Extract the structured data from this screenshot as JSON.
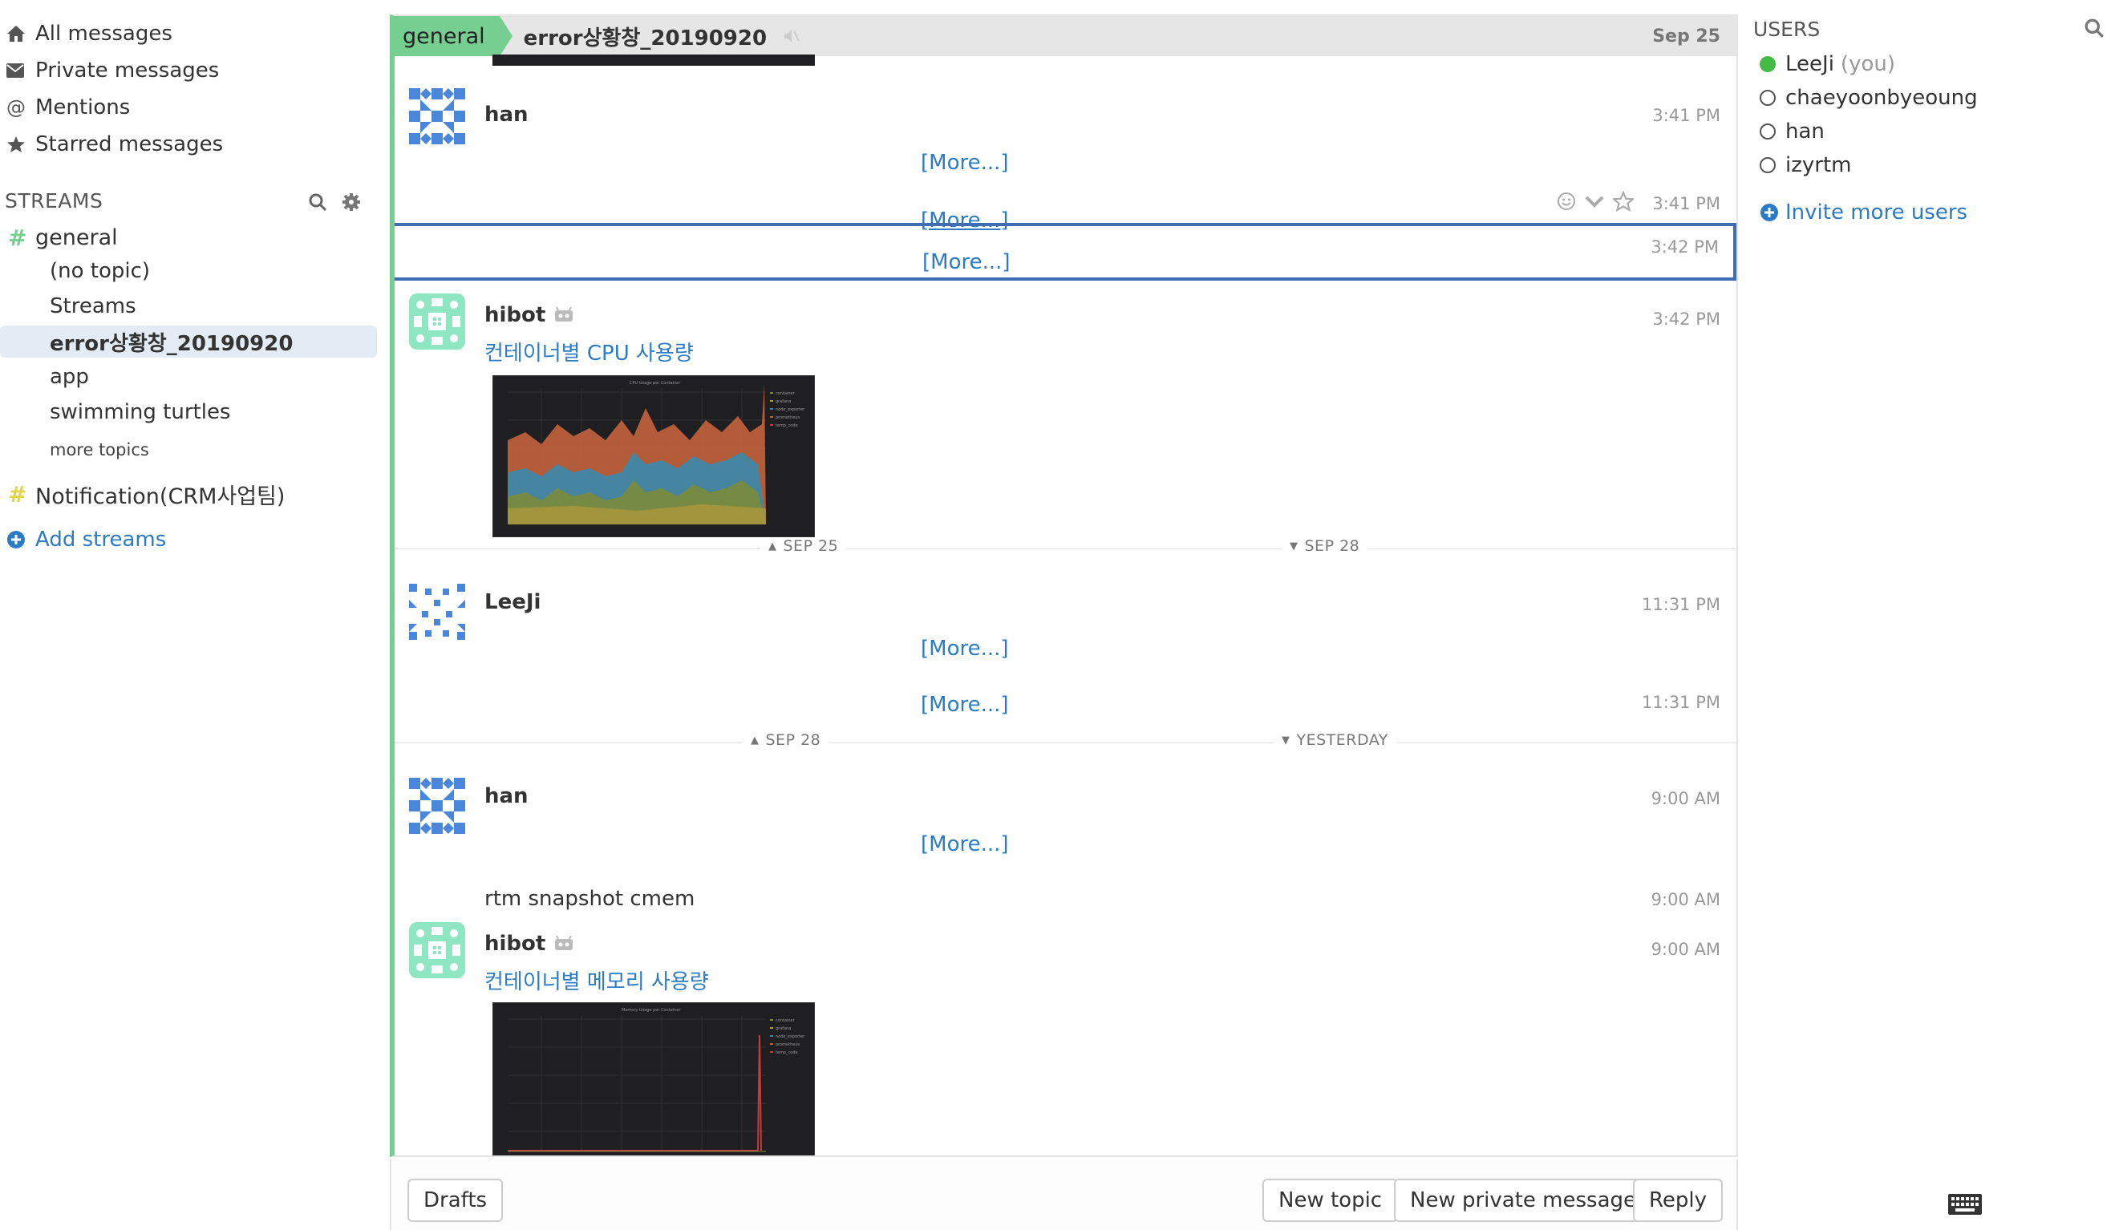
{
  "left_sidebar": {
    "nav": [
      {
        "icon": "home-icon",
        "label": "All messages"
      },
      {
        "icon": "envelope-icon",
        "label": "Private messages"
      },
      {
        "icon": "at-icon",
        "label": "Mentions"
      },
      {
        "icon": "star-icon",
        "label": "Starred messages"
      }
    ],
    "streams_heading": "STREAMS",
    "streams": [
      {
        "name": "general",
        "color": "#76ce90"
      },
      {
        "name": "Notification(CRM사업팀)",
        "color": "#e4d44a"
      }
    ],
    "topics": [
      "(no topic)",
      "Streams",
      "error상황창_20190920",
      "app",
      "swimming turtles"
    ],
    "active_topic": "error상황창_20190920",
    "more_topics": "more topics",
    "add_streams": "Add streams"
  },
  "recipient_bar": {
    "stream": "general",
    "topic": "error상황창_20190920",
    "date": "Sep 25",
    "stream_color": "#76ce90"
  },
  "messages": {
    "m1": {
      "sender": "han",
      "time": "3:41 PM",
      "more": "[More...]"
    },
    "m2": {
      "time": "3:41 PM",
      "more": "[More...]"
    },
    "m3": {
      "time": "3:42 PM",
      "more": "[More...]"
    },
    "m4": {
      "sender": "hibot",
      "time": "3:42 PM",
      "link": "컨테이너별 CPU 사용량"
    },
    "sep1": {
      "left": "SEP 25",
      "right": "SEP 28"
    },
    "m5": {
      "sender": "LeeJi",
      "time": "11:31 PM",
      "more": "[More...]"
    },
    "m6": {
      "time": "11:31 PM",
      "more": "[More...]"
    },
    "sep2": {
      "left": "SEP 28",
      "right": "YESTERDAY"
    },
    "m7": {
      "sender": "han",
      "time": "9:00 AM",
      "more": "[More...]"
    },
    "m8": {
      "time": "9:00 AM",
      "text": "rtm snapshot cmem"
    },
    "m9": {
      "sender": "hibot",
      "time": "9:00 AM",
      "link": "컨테이너별 메모리 사용량"
    }
  },
  "compose": {
    "drafts": "Drafts",
    "new_topic": "New topic",
    "new_private_message": "New private message",
    "reply": "Reply"
  },
  "right_sidebar": {
    "users_heading": "USERS",
    "users": [
      {
        "name": "LeeJi",
        "suffix": "(you)",
        "status": "active"
      },
      {
        "name": "chaeyoonbyeoung",
        "status": "offline"
      },
      {
        "name": "han",
        "status": "offline"
      },
      {
        "name": "izyrtm",
        "status": "offline"
      }
    ],
    "invite": "Invite more users"
  },
  "colors": {
    "link": "#2c7bc4",
    "selected_border": "#3e6db4",
    "active_presence": "#44bb44"
  }
}
